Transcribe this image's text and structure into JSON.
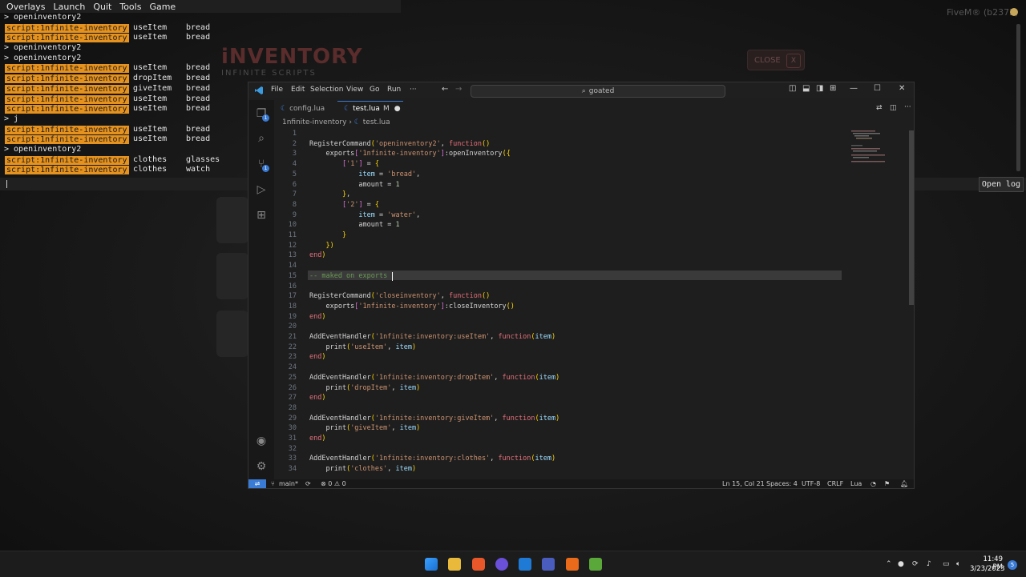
{
  "console": {
    "menu": [
      "Overlays",
      "Launch",
      "Quit",
      "Tools",
      "Game"
    ],
    "lines": [
      {
        "type": "cmd",
        "text": "> openinventory2"
      },
      {
        "type": "log",
        "tag": "script:1nfinite-inventory",
        "c2": "useItem",
        "c3": "bread"
      },
      {
        "type": "log",
        "tag": "script:1nfinite-inventory",
        "c2": "useItem",
        "c3": "bread"
      },
      {
        "type": "cmd",
        "text": "> openinventory2"
      },
      {
        "type": "cmd",
        "text": "> openinventory2"
      },
      {
        "type": "log",
        "tag": "script:1nfinite-inventory",
        "c2": "useItem",
        "c3": "bread"
      },
      {
        "type": "log",
        "tag": "script:1nfinite-inventory",
        "c2": "dropItem",
        "c3": "bread"
      },
      {
        "type": "log",
        "tag": "script:1nfinite-inventory",
        "c2": "giveItem",
        "c3": "bread"
      },
      {
        "type": "log",
        "tag": "script:1nfinite-inventory",
        "c2": "useItem",
        "c3": "bread"
      },
      {
        "type": "log",
        "tag": "script:1nfinite-inventory",
        "c2": "useItem",
        "c3": "bread"
      },
      {
        "type": "cmd",
        "text": "> j"
      },
      {
        "type": "log",
        "tag": "script:1nfinite-inventory",
        "c2": "useItem",
        "c3": "bread"
      },
      {
        "type": "log",
        "tag": "script:1nfinite-inventory",
        "c2": "useItem",
        "c3": "bread"
      },
      {
        "type": "cmd",
        "text": "> openinventory2"
      },
      {
        "type": "log",
        "tag": "script:1nfinite-inventory",
        "c2": "clothes",
        "c3": "glasses"
      },
      {
        "type": "log",
        "tag": "script:1nfinite-inventory",
        "c2": "clothes",
        "c3": "watch"
      }
    ],
    "open_log_label": "Open log"
  },
  "game": {
    "title": "iNVENTORY",
    "subtitle": "INFINITE SCRIPTS",
    "close_label": "CLOSE",
    "close_x": "X",
    "fivem_version": "FiveM® (b2372)"
  },
  "vscode": {
    "menus": [
      "File",
      "Edit",
      "Selection",
      "View",
      "Go",
      "Run",
      "···"
    ],
    "search": "goated",
    "tabs": [
      {
        "label": "config.lua",
        "active": false
      },
      {
        "label": "test.lua",
        "modified": "M",
        "active": true
      }
    ],
    "breadcrumb": [
      "1nfinite-inventory",
      "test.lua"
    ],
    "code": [
      "",
      "RegisterCommand('openinventory2', function()",
      "    exports['1nfinite-inventory']:openInventory({",
      "        ['1'] = {",
      "            item = 'bread',",
      "            amount = 1",
      "        },",
      "        ['2'] = {",
      "            item = 'water',",
      "            amount = 1",
      "        }",
      "    })",
      "end)",
      "",
      "-- maked on exports",
      "",
      "RegisterCommand('closeinventory', function()",
      "    exports['1nfinite-inventory']:closeInventory()",
      "end)",
      "",
      "AddEventHandler('1nfinite:inventory:useItem', function(item)",
      "    print('useItem', item)",
      "end)",
      "",
      "AddEventHandler('1nfinite:inventory:dropItem', function(item)",
      "    print('dropItem', item)",
      "end)",
      "",
      "AddEventHandler('1nfinite:inventory:giveItem', function(item)",
      "    print('giveItem', item)",
      "end)",
      "",
      "AddEventHandler('1nfinite:inventory:clothes', function(item)",
      "    print('clothes', item)"
    ],
    "status": {
      "branch": "main*",
      "problems": "⊗ 0 ⚠ 0",
      "position": "Ln 15, Col 21",
      "spaces": "Spaces: 4",
      "encoding": "UTF-8",
      "eol": "CRLF",
      "language": "Lua"
    }
  },
  "taskbar": {
    "time": "11:49 PM",
    "date": "3/23/2023"
  },
  "colors": {
    "console_tag": "#e6921e",
    "vscode_accent": "#3a7bd5",
    "keyword": "#e5707b",
    "string": "#cc9270"
  }
}
